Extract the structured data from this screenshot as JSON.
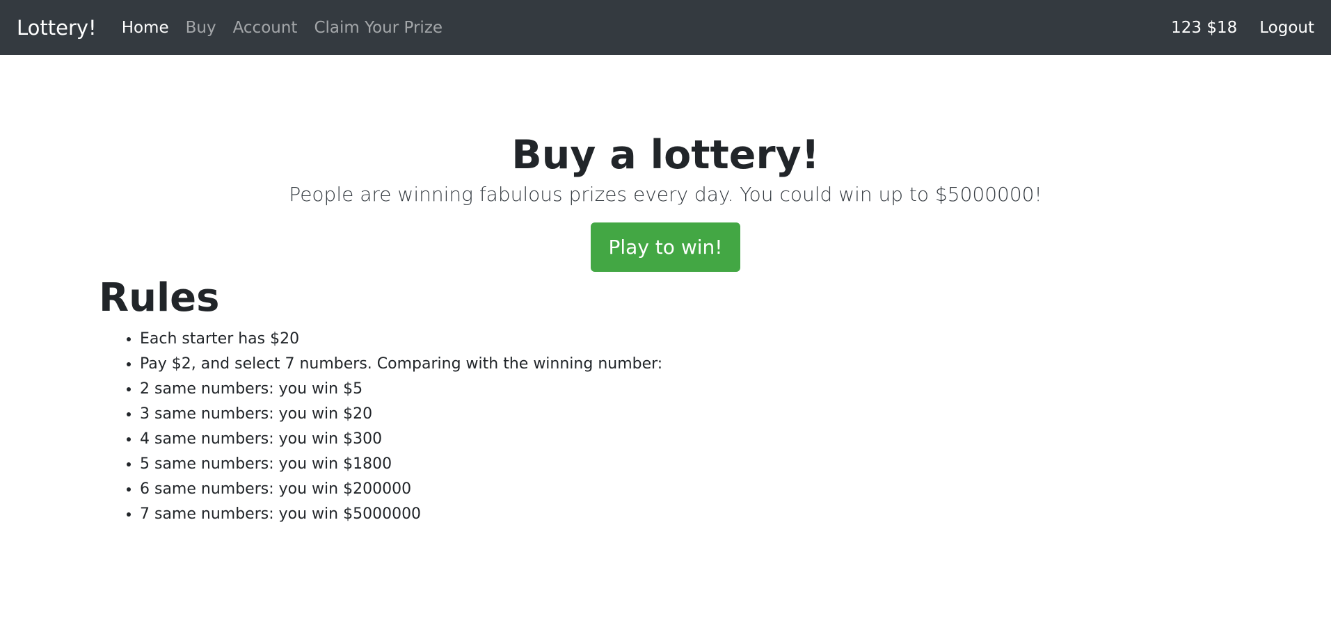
{
  "navbar": {
    "brand": "Lottery!",
    "links": [
      {
        "label": "Home",
        "active": true
      },
      {
        "label": "Buy",
        "active": false
      },
      {
        "label": "Account",
        "active": false
      },
      {
        "label": "Claim Your Prize",
        "active": false
      }
    ],
    "balance": "123 $18",
    "logout": "Logout",
    "colors": {
      "background": "#343a40"
    }
  },
  "hero": {
    "title": "Buy a lottery!",
    "lead": "People are winning fabulous prizes every day. You could win up to $5000000!",
    "button": "Play to win!",
    "button_color": "#43a744"
  },
  "rules": {
    "title": "Rules",
    "items": [
      "Each starter has $20",
      "Pay $2, and select 7 numbers. Comparing with the winning number:",
      "2 same numbers: you win $5",
      "3 same numbers: you win $20",
      "4 same numbers: you win $300",
      "5 same numbers: you win $1800",
      "6 same numbers: you win $200000",
      "7 same numbers: you win $5000000"
    ]
  }
}
